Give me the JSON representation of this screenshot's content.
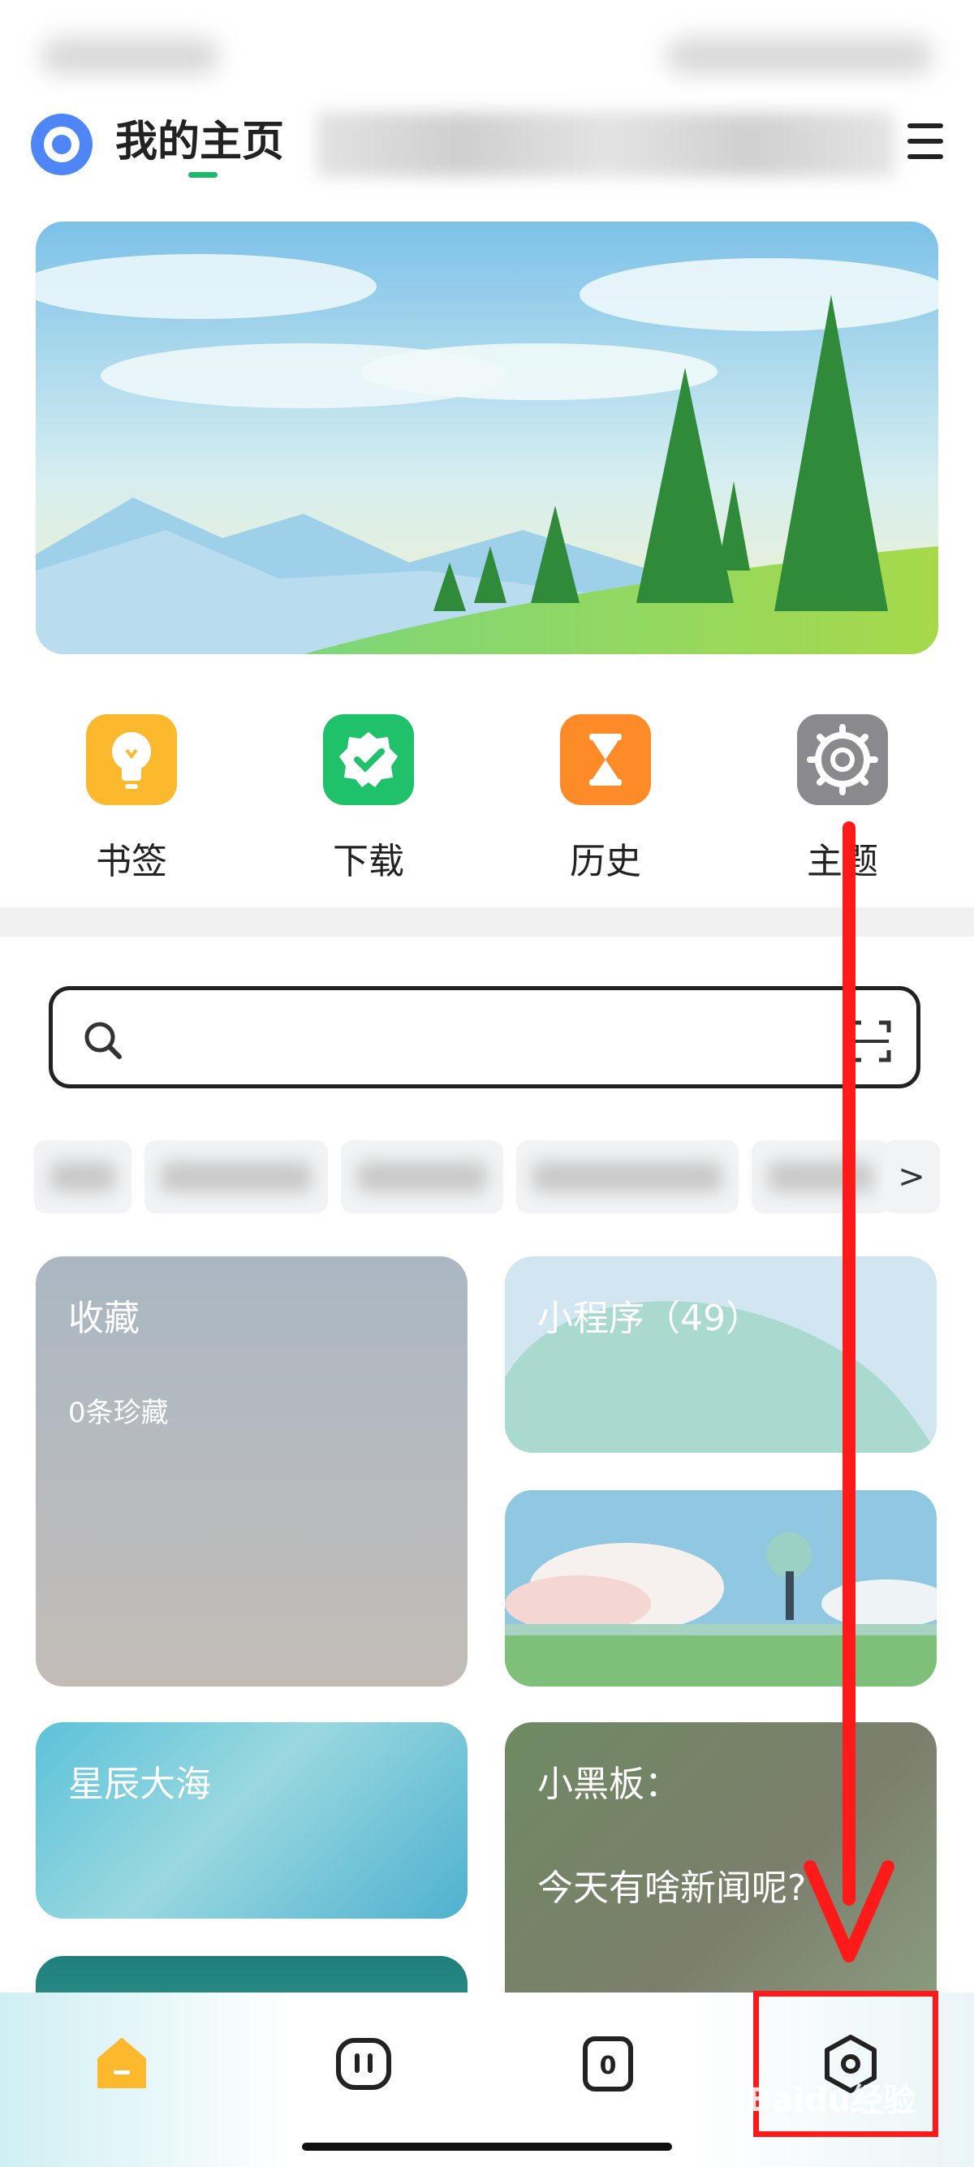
{
  "header": {
    "title": "我的主页",
    "logo_icon": "browser-logo-icon",
    "menu_icon": "hamburger-menu-icon"
  },
  "quick_actions": [
    {
      "label": "书签",
      "icon": "lightbulb-icon",
      "color": "#fdb92e"
    },
    {
      "label": "下载",
      "icon": "verified-badge-icon",
      "color": "#1fc16b"
    },
    {
      "label": "历史",
      "icon": "hourglass-icon",
      "color": "#ff8a28"
    },
    {
      "label": "主题",
      "icon": "gear-icon",
      "color": "#8a8a8e"
    }
  ],
  "search": {
    "placeholder": "",
    "scan_icon": "scan-icon"
  },
  "chips": {
    "more_label": ">"
  },
  "cards": {
    "favorites": {
      "title": "收藏",
      "subtitle": "0条珍藏"
    },
    "mini_programs": {
      "title": "小程序（49）"
    },
    "ocean": {
      "title": "星辰大海"
    },
    "blackboard": {
      "title": "小黑板：",
      "body": "今天有啥新闻呢?"
    }
  },
  "bottom_nav": [
    {
      "name": "home",
      "icon": "home-icon",
      "active": true
    },
    {
      "name": "pause",
      "icon": "pause-tab-icon"
    },
    {
      "name": "tabs",
      "icon": "tab-count-icon",
      "count": "0"
    },
    {
      "name": "settings",
      "icon": "hexagon-settings-icon"
    }
  ],
  "watermark": "Baidu经验",
  "colors": {
    "accent_red": "#ff1a1a",
    "accent_green": "#1fb86a",
    "home_orange": "#fdb92e"
  }
}
